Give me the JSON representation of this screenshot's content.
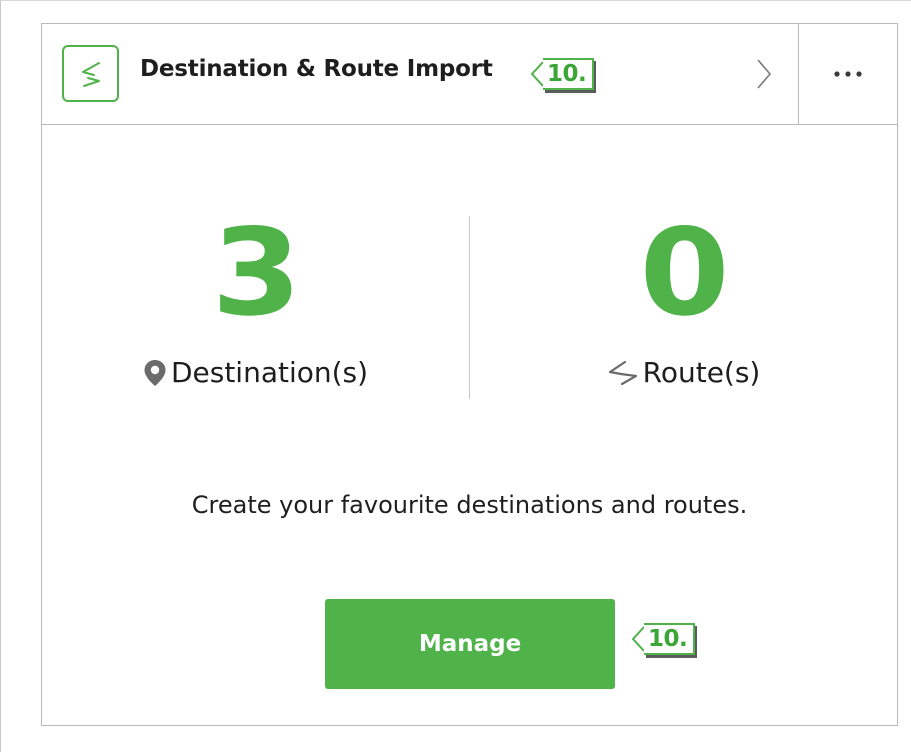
{
  "card": {
    "title": "Destination & Route Import",
    "header_icon": "route-import-icon",
    "chevron_icon": "chevron-right-icon",
    "more_icon": "more-horizontal-icon"
  },
  "callouts": {
    "header": "10.",
    "manage": "10."
  },
  "stats": {
    "destinations": {
      "value": "3",
      "label": "Destination(s)",
      "icon": "map-pin-icon"
    },
    "routes": {
      "value": "0",
      "label": "Route(s)",
      "icon": "route-icon"
    }
  },
  "description": "Create your favourite destinations and routes.",
  "actions": {
    "manage_label": "Manage"
  },
  "colors": {
    "accent": "#4fb349",
    "text": "#1e1e1e",
    "border": "#b9b9b9",
    "icon_gray": "#6b6b6b"
  }
}
